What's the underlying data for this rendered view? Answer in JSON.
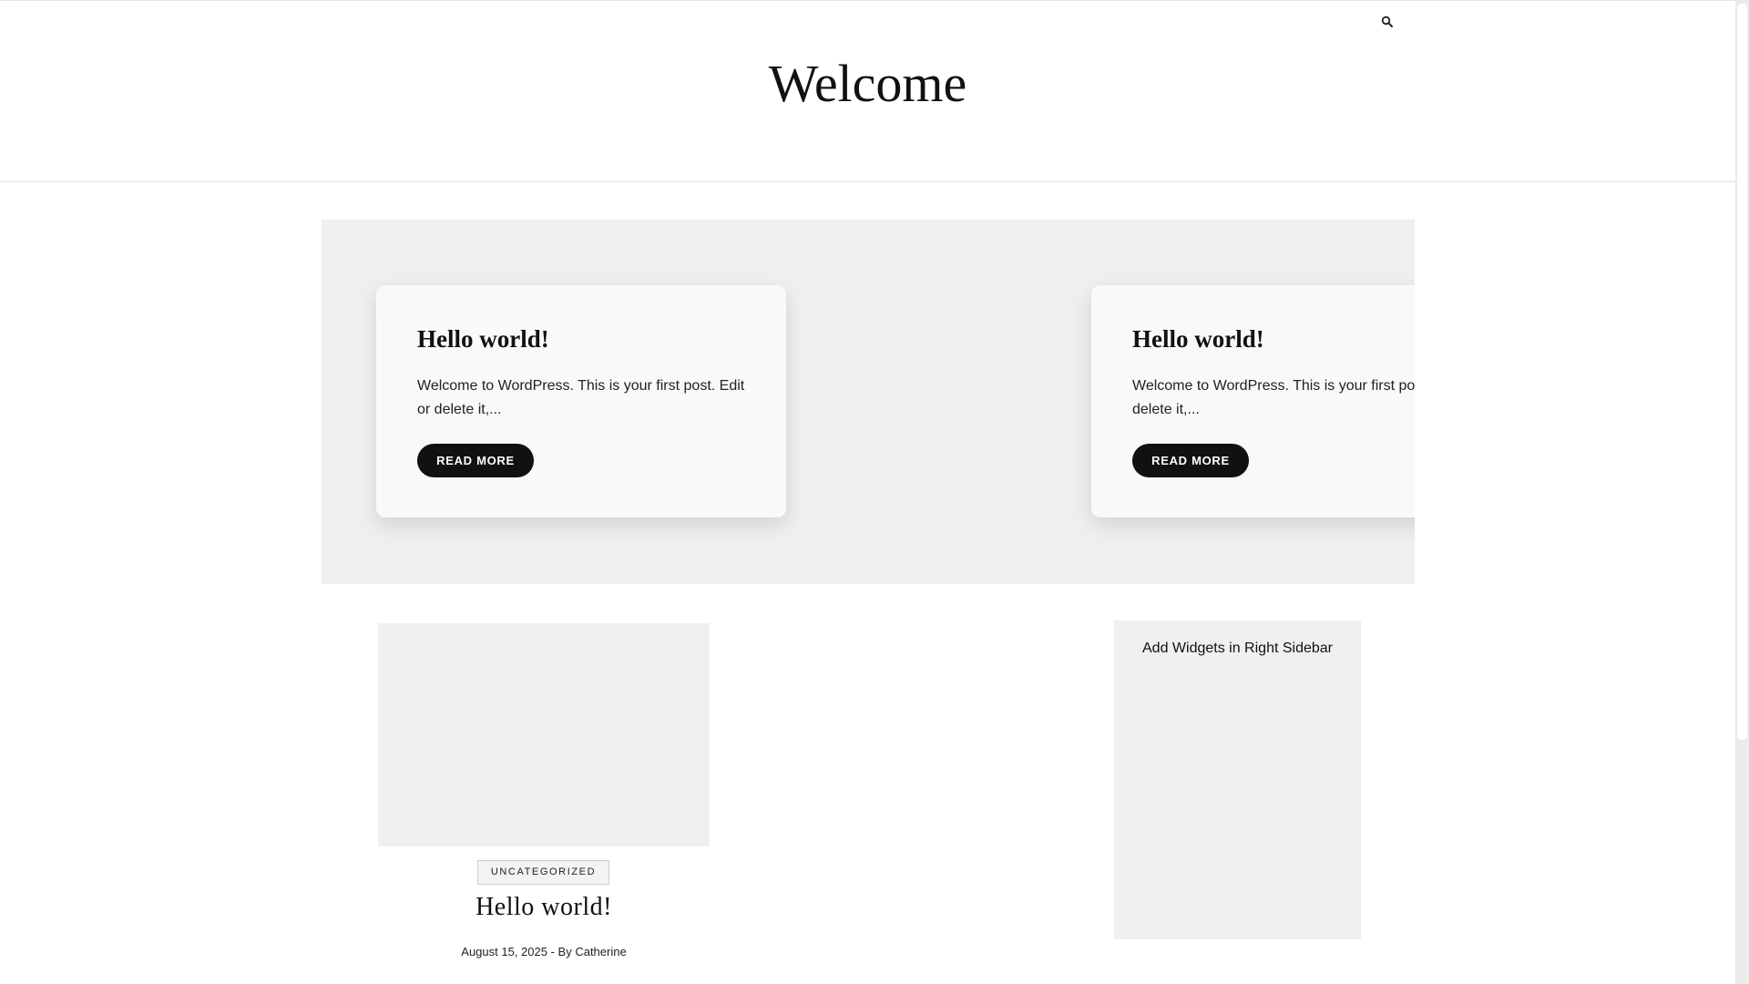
{
  "header": {
    "site_title": "Welcome",
    "search_icon": "search-icon"
  },
  "slider": {
    "slides": [
      {
        "title": "Hello world!",
        "excerpt": "Welcome to WordPress. This is your first post. Edit or delete it,...",
        "button_label": "READ MORE"
      },
      {
        "title": "Hello world!",
        "excerpt": "Welcome to WordPress. This is your first post. Edit or delete it,...",
        "button_label": "READ MORE"
      }
    ]
  },
  "post": {
    "category": "UNCATEGORIZED",
    "title": "Hello world!",
    "date": "August 15, 2025",
    "by_prefix": " - By ",
    "author": "Catherine"
  },
  "sidebar": {
    "widget_text": "Add Widgets in Right Sidebar"
  },
  "colors": {
    "button_background": "#111111",
    "slider_background": "#efefef",
    "sidebar_background": "#f0f0f0"
  }
}
